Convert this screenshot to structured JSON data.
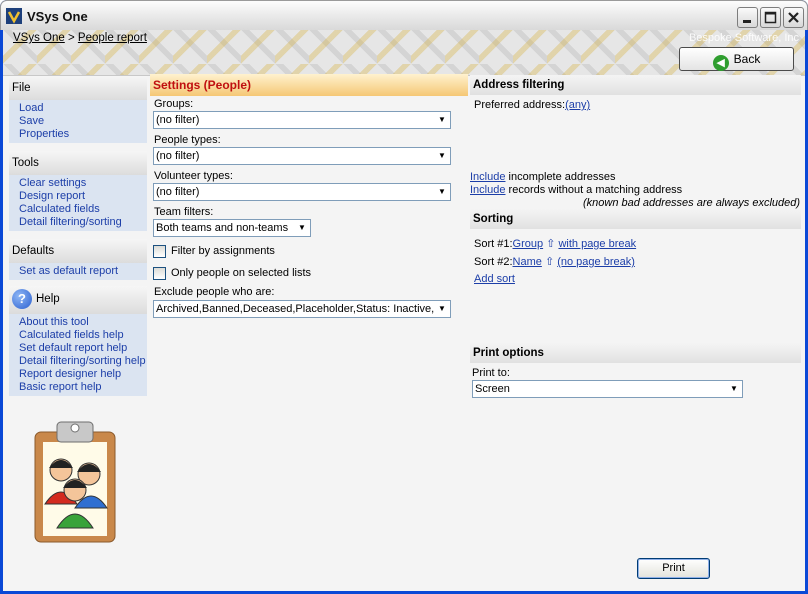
{
  "window": {
    "title": "VSys One"
  },
  "breadcrumb": {
    "root": "VSys One",
    "separator": ">",
    "current": "People report"
  },
  "company": "Bespoke Software, Inc",
  "back_button": "Back",
  "nav": {
    "file": {
      "title": "File",
      "items": [
        "Load",
        "Save",
        "Properties"
      ]
    },
    "tools": {
      "title": "Tools",
      "items": [
        "Clear settings",
        "Design report",
        "Calculated fields",
        "Detail filtering/sorting"
      ]
    },
    "defaults": {
      "title": "Defaults",
      "items": [
        "Set as default report"
      ]
    },
    "help": {
      "title": "Help",
      "items": [
        "About this tool",
        "Calculated fields help",
        "Set default report help",
        "Detail filtering/sorting help",
        "Report designer help",
        "Basic report help"
      ]
    }
  },
  "settings": {
    "header": "Settings (People)",
    "groups_label": "Groups:",
    "groups_value": "(no filter)",
    "people_types_label": "People types:",
    "people_types_value": "(no filter)",
    "volunteer_types_label": "Volunteer types:",
    "volunteer_types_value": "(no filter)",
    "team_filters_label": "Team filters:",
    "team_filters_value": "Both teams and non-teams",
    "filter_by_assignments": "Filter by assignments",
    "only_selected_lists": "Only people on selected lists",
    "exclude_label": "Exclude people who are:",
    "exclude_value": "Archived,Banned,Deceased,Placeholder,Status: Inactive,"
  },
  "address": {
    "header": "Address filtering",
    "preferred_label": "Preferred address:",
    "preferred_value": "(any)",
    "include_link": "Include",
    "incomplete_text": " incomplete addresses",
    "without_text": " records without a matching address",
    "note": "(known bad addresses are always excluded)"
  },
  "sorting": {
    "header": "Sorting",
    "sort1_label": "Sort #1:",
    "sort1_field": "Group",
    "sort1_break": "with page break",
    "sort2_label": "Sort #2:",
    "sort2_field": "Name",
    "sort2_break": "(no page break)",
    "arrow": "⇧",
    "add_sort": "Add sort"
  },
  "print": {
    "header": "Print options",
    "print_to_label": "Print to:",
    "print_to_value": "Screen",
    "button": "Print"
  }
}
